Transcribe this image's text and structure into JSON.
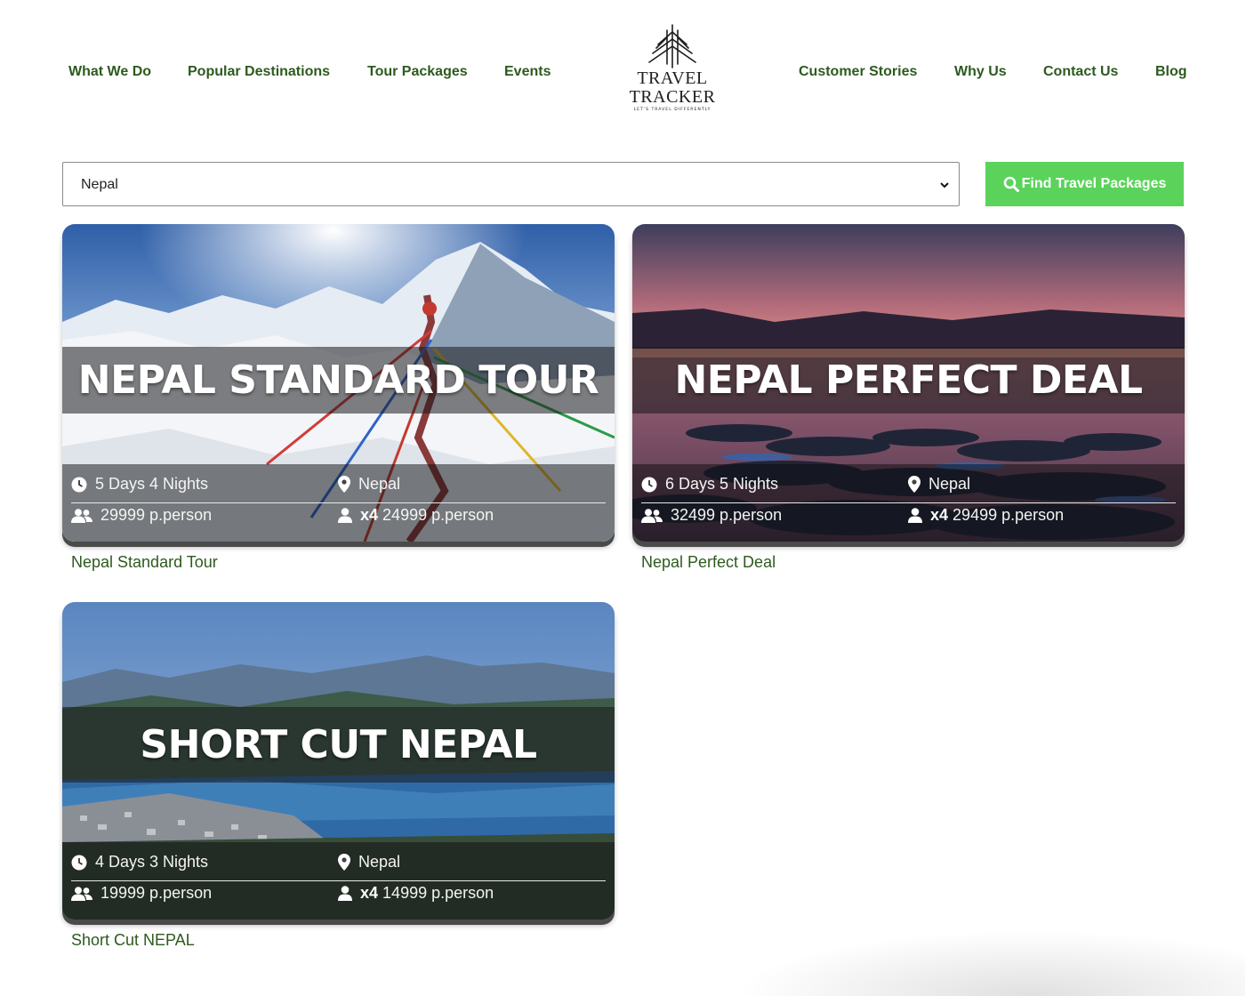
{
  "nav": {
    "left": [
      "What We Do",
      "Popular Destinations",
      "Tour Packages",
      "Events"
    ],
    "right": [
      "Customer Stories",
      "Why Us",
      "Contact Us",
      "Blog"
    ]
  },
  "logo": {
    "line1": "TRAVEL",
    "line2": "TRACKER",
    "tagline": "LET'S TRAVEL DIFFERENTLY"
  },
  "search": {
    "selected_value": "Nepal",
    "button_label": "Find Travel Packages",
    "button_icon": "search-icon"
  },
  "packages": [
    {
      "image_title": "NEPAL STANDARD TOUR",
      "duration": "5 Days 4 Nights",
      "location": "Nepal",
      "group_price": "29999 p.person",
      "multiplier": "x4",
      "single_price": "24999 p.person",
      "link_text": "Nepal Standard Tour"
    },
    {
      "image_title": "NEPAL PERFECT DEAL",
      "duration": "6 Days 5 Nights",
      "location": "Nepal",
      "group_price": "32499 p.person",
      "multiplier": "x4",
      "single_price": "29499 p.person",
      "link_text": "Nepal Perfect Deal"
    },
    {
      "image_title": "SHORT CUT NEPAL",
      "duration": "4 Days 3 Nights",
      "location": "Nepal",
      "group_price": "19999 p.person",
      "multiplier": "x4",
      "single_price": "14999 p.person",
      "link_text": "Short Cut NEPAL"
    }
  ],
  "colors": {
    "nav_text": "#2d5a1e",
    "button_bg": "#5bd35b",
    "card_link": "#2d5a1e"
  }
}
